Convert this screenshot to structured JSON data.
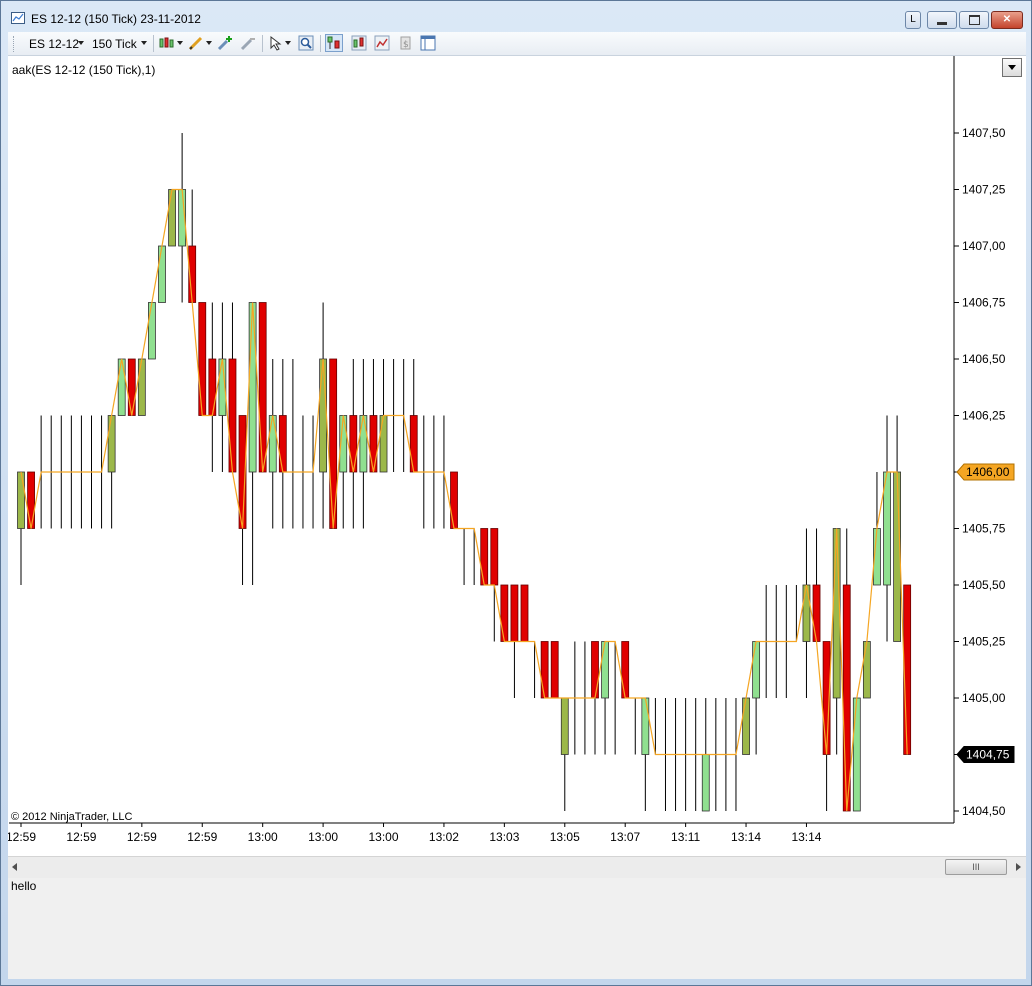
{
  "window": {
    "title": "ES 12-12 (150 Tick)  23-11-2012",
    "buttons": {
      "link": "L"
    }
  },
  "toolbar": {
    "instrument": "ES 12-12",
    "interval": "150 Tick",
    "icons": [
      "chart-style-icon",
      "drawing-tool-icon",
      "add-drawing-icon",
      "remove-drawing-icon",
      "cursor-icon",
      "zoom-icon",
      "data-box-icon",
      "indicators-icon",
      "strategies-icon",
      "properties-icon",
      "panels-icon"
    ]
  },
  "chart": {
    "indicator_label": "aak(ES 12-12 (150 Tick),1)",
    "copyright": "© 2012 NinjaTrader, LLC"
  },
  "statusbar": {
    "text": "hello"
  },
  "scrollbar": {
    "thumb_grip": "III"
  },
  "chart_data": {
    "type": "candlestick",
    "instrument": "ES 12-12",
    "interval": "150 Tick",
    "date": "23-11-2012",
    "yticks": [
      "1407,50",
      "1407,25",
      "1407,00",
      "1406,75",
      "1406,50",
      "1406,25",
      "1406,00",
      "1405,75",
      "1405,50",
      "1405,25",
      "1405,00",
      "1404,75",
      "1404,50"
    ],
    "ylim": [
      1404.33,
      1407.75
    ],
    "xticks": [
      "12:59",
      "12:59",
      "12:59",
      "12:59",
      "13:00",
      "13:00",
      "13:00",
      "13:02",
      "13:03",
      "13:05",
      "13:07",
      "13:11",
      "13:14",
      "13:14"
    ],
    "price_markers": [
      {
        "label": "1406,00",
        "value": 1406.0,
        "color": "#f5a623"
      },
      {
        "label": "1404,75",
        "value": 1404.75,
        "color": "#000000"
      }
    ],
    "colors": {
      "up": "#90e090",
      "up_alt": "#9cb84a",
      "down": "#e00000",
      "wick": "#000000",
      "line": "#f5a623"
    },
    "bars": [
      {
        "o": 1405.75,
        "h": 1406.0,
        "l": 1405.5,
        "c": 1406.0
      },
      {
        "o": 1406.0,
        "h": 1406.0,
        "l": 1405.75,
        "c": 1405.75
      },
      {
        "o": 1406.0,
        "h": 1406.25,
        "l": 1405.75,
        "c": 1406.0
      },
      {
        "o": 1406.0,
        "h": 1406.25,
        "l": 1405.75,
        "c": 1406.0
      },
      {
        "o": 1406.0,
        "h": 1406.25,
        "l": 1405.75,
        "c": 1406.0
      },
      {
        "o": 1406.0,
        "h": 1406.25,
        "l": 1405.75,
        "c": 1406.0
      },
      {
        "o": 1406.0,
        "h": 1406.25,
        "l": 1405.75,
        "c": 1406.0
      },
      {
        "o": 1406.0,
        "h": 1406.25,
        "l": 1405.75,
        "c": 1406.0
      },
      {
        "o": 1406.0,
        "h": 1406.25,
        "l": 1405.75,
        "c": 1406.0
      },
      {
        "o": 1406.0,
        "h": 1406.25,
        "l": 1405.75,
        "c": 1406.25
      },
      {
        "o": 1406.25,
        "h": 1406.5,
        "l": 1406.25,
        "c": 1406.5
      },
      {
        "o": 1406.5,
        "h": 1406.5,
        "l": 1406.25,
        "c": 1406.25
      },
      {
        "o": 1406.25,
        "h": 1406.5,
        "l": 1406.25,
        "c": 1406.5
      },
      {
        "o": 1406.5,
        "h": 1406.75,
        "l": 1406.5,
        "c": 1406.75
      },
      {
        "o": 1406.75,
        "h": 1407.0,
        "l": 1406.75,
        "c": 1407.0
      },
      {
        "o": 1407.0,
        "h": 1407.25,
        "l": 1407.0,
        "c": 1407.25
      },
      {
        "o": 1407.0,
        "h": 1407.5,
        "l": 1406.75,
        "c": 1407.25
      },
      {
        "o": 1407.0,
        "h": 1407.25,
        "l": 1406.75,
        "c": 1406.75
      },
      {
        "o": 1406.75,
        "h": 1406.75,
        "l": 1406.25,
        "c": 1406.25
      },
      {
        "o": 1406.5,
        "h": 1406.75,
        "l": 1406.0,
        "c": 1406.25
      },
      {
        "o": 1406.25,
        "h": 1406.75,
        "l": 1406.0,
        "c": 1406.5
      },
      {
        "o": 1406.5,
        "h": 1406.75,
        "l": 1406.0,
        "c": 1406.0
      },
      {
        "o": 1406.25,
        "h": 1406.25,
        "l": 1405.5,
        "c": 1405.75
      },
      {
        "o": 1406.0,
        "h": 1406.75,
        "l": 1405.5,
        "c": 1406.75
      },
      {
        "o": 1406.75,
        "h": 1406.75,
        "l": 1406.0,
        "c": 1406.0
      },
      {
        "o": 1406.0,
        "h": 1406.5,
        "l": 1405.75,
        "c": 1406.25
      },
      {
        "o": 1406.25,
        "h": 1406.5,
        "l": 1405.75,
        "c": 1406.0
      },
      {
        "o": 1406.0,
        "h": 1406.5,
        "l": 1405.75,
        "c": 1406.0
      },
      {
        "o": 1406.0,
        "h": 1406.25,
        "l": 1405.75,
        "c": 1406.0
      },
      {
        "o": 1406.0,
        "h": 1406.25,
        "l": 1405.75,
        "c": 1406.0
      },
      {
        "o": 1406.0,
        "h": 1406.75,
        "l": 1405.75,
        "c": 1406.5
      },
      {
        "o": 1406.5,
        "h": 1406.5,
        "l": 1405.75,
        "c": 1405.75
      },
      {
        "o": 1406.0,
        "h": 1406.25,
        "l": 1405.75,
        "c": 1406.25
      },
      {
        "o": 1406.25,
        "h": 1406.5,
        "l": 1405.75,
        "c": 1406.0
      },
      {
        "o": 1406.0,
        "h": 1406.5,
        "l": 1405.75,
        "c": 1406.25
      },
      {
        "o": 1406.25,
        "h": 1406.5,
        "l": 1406.0,
        "c": 1406.0
      },
      {
        "o": 1406.0,
        "h": 1406.5,
        "l": 1406.0,
        "c": 1406.25
      },
      {
        "o": 1406.25,
        "h": 1406.5,
        "l": 1406.0,
        "c": 1406.25
      },
      {
        "o": 1406.25,
        "h": 1406.5,
        "l": 1406.0,
        "c": 1406.25
      },
      {
        "o": 1406.25,
        "h": 1406.5,
        "l": 1406.0,
        "c": 1406.0
      },
      {
        "o": 1406.0,
        "h": 1406.25,
        "l": 1405.75,
        "c": 1406.0
      },
      {
        "o": 1406.0,
        "h": 1406.25,
        "l": 1405.75,
        "c": 1406.0
      },
      {
        "o": 1406.0,
        "h": 1406.25,
        "l": 1405.75,
        "c": 1406.0
      },
      {
        "o": 1406.0,
        "h": 1406.0,
        "l": 1405.75,
        "c": 1405.75
      },
      {
        "o": 1405.75,
        "h": 1405.75,
        "l": 1405.5,
        "c": 1405.75
      },
      {
        "o": 1405.75,
        "h": 1405.75,
        "l": 1405.5,
        "c": 1405.75
      },
      {
        "o": 1405.75,
        "h": 1405.75,
        "l": 1405.5,
        "c": 1405.5
      },
      {
        "o": 1405.75,
        "h": 1405.75,
        "l": 1405.25,
        "c": 1405.5
      },
      {
        "o": 1405.5,
        "h": 1405.5,
        "l": 1405.25,
        "c": 1405.25
      },
      {
        "o": 1405.5,
        "h": 1405.5,
        "l": 1405.0,
        "c": 1405.25
      },
      {
        "o": 1405.5,
        "h": 1405.5,
        "l": 1405.25,
        "c": 1405.25
      },
      {
        "o": 1405.25,
        "h": 1405.25,
        "l": 1405.0,
        "c": 1405.25
      },
      {
        "o": 1405.25,
        "h": 1405.25,
        "l": 1405.0,
        "c": 1405.0
      },
      {
        "o": 1405.25,
        "h": 1405.25,
        "l": 1405.0,
        "c": 1405.0
      },
      {
        "o": 1404.75,
        "h": 1405.0,
        "l": 1404.5,
        "c": 1405.0
      },
      {
        "o": 1405.0,
        "h": 1405.25,
        "l": 1404.75,
        "c": 1405.0
      },
      {
        "o": 1405.0,
        "h": 1405.25,
        "l": 1404.75,
        "c": 1405.0
      },
      {
        "o": 1405.25,
        "h": 1405.25,
        "l": 1404.75,
        "c": 1405.0
      },
      {
        "o": 1405.0,
        "h": 1405.25,
        "l": 1404.75,
        "c": 1405.25
      },
      {
        "o": 1405.25,
        "h": 1405.25,
        "l": 1404.75,
        "c": 1405.25
      },
      {
        "o": 1405.25,
        "h": 1405.25,
        "l": 1405.0,
        "c": 1405.0
      },
      {
        "o": 1405.0,
        "h": 1405.0,
        "l": 1404.75,
        "c": 1405.0
      },
      {
        "o": 1404.75,
        "h": 1405.0,
        "l": 1404.5,
        "c": 1405.0
      },
      {
        "o": 1404.75,
        "h": 1405.0,
        "l": 1404.75,
        "c": 1404.75
      },
      {
        "o": 1404.75,
        "h": 1405.0,
        "l": 1404.5,
        "c": 1404.75
      },
      {
        "o": 1404.75,
        "h": 1405.0,
        "l": 1404.5,
        "c": 1404.75
      },
      {
        "o": 1404.75,
        "h": 1405.0,
        "l": 1404.5,
        "c": 1404.75
      },
      {
        "o": 1404.75,
        "h": 1405.0,
        "l": 1404.5,
        "c": 1404.75
      },
      {
        "o": 1404.5,
        "h": 1405.0,
        "l": 1404.5,
        "c": 1404.75
      },
      {
        "o": 1404.75,
        "h": 1405.0,
        "l": 1404.5,
        "c": 1404.75
      },
      {
        "o": 1404.75,
        "h": 1405.0,
        "l": 1404.5,
        "c": 1404.75
      },
      {
        "o": 1404.75,
        "h": 1405.0,
        "l": 1404.5,
        "c": 1404.75
      },
      {
        "o": 1404.75,
        "h": 1405.0,
        "l": 1404.75,
        "c": 1405.0
      },
      {
        "o": 1405.0,
        "h": 1405.25,
        "l": 1404.75,
        "c": 1405.25
      },
      {
        "o": 1405.25,
        "h": 1405.5,
        "l": 1405.0,
        "c": 1405.25
      },
      {
        "o": 1405.25,
        "h": 1405.5,
        "l": 1405.0,
        "c": 1405.25
      },
      {
        "o": 1405.25,
        "h": 1405.5,
        "l": 1405.0,
        "c": 1405.25
      },
      {
        "o": 1405.25,
        "h": 1405.5,
        "l": 1405.25,
        "c": 1405.25
      },
      {
        "o": 1405.25,
        "h": 1405.75,
        "l": 1405.0,
        "c": 1405.5
      },
      {
        "o": 1405.5,
        "h": 1405.75,
        "l": 1405.25,
        "c": 1405.25
      },
      {
        "o": 1405.25,
        "h": 1405.25,
        "l": 1404.5,
        "c": 1404.75
      },
      {
        "o": 1405.0,
        "h": 1405.75,
        "l": 1404.75,
        "c": 1405.75
      },
      {
        "o": 1405.5,
        "h": 1405.75,
        "l": 1404.5,
        "c": 1404.5
      },
      {
        "o": 1404.5,
        "h": 1405.0,
        "l": 1404.5,
        "c": 1405.0
      },
      {
        "o": 1405.0,
        "h": 1405.25,
        "l": 1405.0,
        "c": 1405.25
      },
      {
        "o": 1405.5,
        "h": 1406.0,
        "l": 1405.5,
        "c": 1405.75
      },
      {
        "o": 1405.5,
        "h": 1406.25,
        "l": 1405.25,
        "c": 1406.0
      },
      {
        "o": 1405.25,
        "h": 1406.25,
        "l": 1405.25,
        "c": 1406.0
      },
      {
        "o": 1405.5,
        "h": 1405.5,
        "l": 1404.75,
        "c": 1404.75
      }
    ]
  }
}
